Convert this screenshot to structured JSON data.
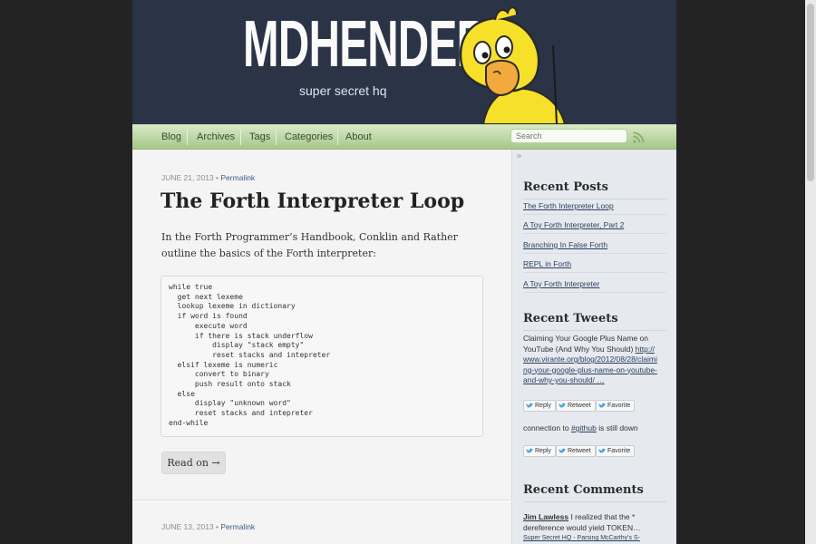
{
  "header": {
    "site_title": "MDHENDER",
    "subtitle": "super secret hq",
    "mascot_icon": "duck-icon"
  },
  "nav": {
    "items": [
      {
        "label": "Blog"
      },
      {
        "label": "Archives"
      },
      {
        "label": "Tags"
      },
      {
        "label": "Categories"
      },
      {
        "label": "About"
      }
    ],
    "search_placeholder": "Search",
    "rss_icon": "rss-icon"
  },
  "posts": [
    {
      "date": "JUNE 21, 2013",
      "separator": "•",
      "permalink_label": "Permalink",
      "title": "The Forth Interpreter Loop",
      "intro": "In the Forth Programmer’s Handbook, Conklin and Rather outline the basics of the Forth interpreter:",
      "code": "while true\n  get next lexeme\n  lookup lexeme in dictionary\n  if word is found\n      execute word\n      if there is stack underflow\n          display \"stack empty\"\n          reset stacks and intepreter\n  elsif lexeme is numeric\n      convert to binary\n      push result onto stack\n  else\n      display \"unknown word\"\n      reset stacks and intepreter\nend-while",
      "read_on_label": "Read on →"
    },
    {
      "date": "JUNE 13, 2013",
      "separator": "•",
      "permalink_label": "Permalink"
    }
  ],
  "sidebar": {
    "toggle_label": "»",
    "recent_posts": {
      "heading": "Recent Posts",
      "items": [
        {
          "label": "The Forth Interpreter Loop"
        },
        {
          "label": "A Toy Forth Interpreter, Part 2"
        },
        {
          "label": "Branching In False Forth"
        },
        {
          "label": "REPL in Forth"
        },
        {
          "label": "A Toy Forth Interpreter"
        }
      ]
    },
    "recent_tweets": {
      "heading": "Recent Tweets",
      "tweets": [
        {
          "text": "Claiming Your Google Plus Name on YouTube (And Why You Should)",
          "link": "http://www.virante.org/blog/2012/08/28/claiming-your-google-plus-name-on-youtube-and-why-you-should/ …"
        },
        {
          "text_before": "connection to ",
          "hashtag": "#github",
          "text_after": " is still down"
        }
      ],
      "actions": [
        "Reply",
        "Retweet",
        "Favorite"
      ]
    },
    "recent_comments": {
      "heading": "Recent Comments",
      "items": [
        {
          "author": "Jim Lawless",
          "text": " I realized that the * dereference would yield TOKEN…",
          "link": "Super Secret HQ - Parsing McCarthy's S-"
        }
      ]
    }
  },
  "colors": {
    "header_bg": "#2b3446",
    "nav_green": "#a7c78a",
    "sidebar_bg": "#e6eaef",
    "link": "#2b3f5f",
    "duck_yellow": "#f7e02a",
    "duck_beak": "#f3a93c"
  }
}
